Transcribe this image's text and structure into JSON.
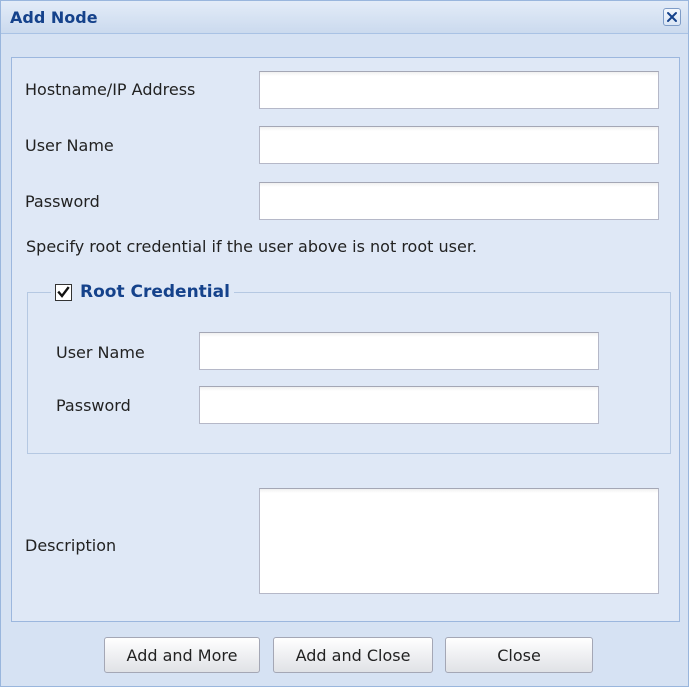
{
  "dialog": {
    "title": "Add Node",
    "close_icon": "close-icon"
  },
  "form": {
    "hostname_label": "Hostname/IP Address",
    "hostname_value": "",
    "username_label": "User Name",
    "username_value": "",
    "password_label": "Password",
    "password_value": "",
    "note": "Specify root credential if the user above is not root user.",
    "root_credential": {
      "legend": "Root Credential",
      "checked": true,
      "username_label": "User Name",
      "username_value": "",
      "password_label": "Password",
      "password_value": ""
    },
    "description_label": "Description",
    "description_value": ""
  },
  "buttons": {
    "add_more": "Add and More",
    "add_close": "Add and Close",
    "close": "Close"
  },
  "colors": {
    "title_text": "#15428b",
    "panel_bg": "#dfe8f6",
    "frame_bg": "#d6e2f3"
  }
}
